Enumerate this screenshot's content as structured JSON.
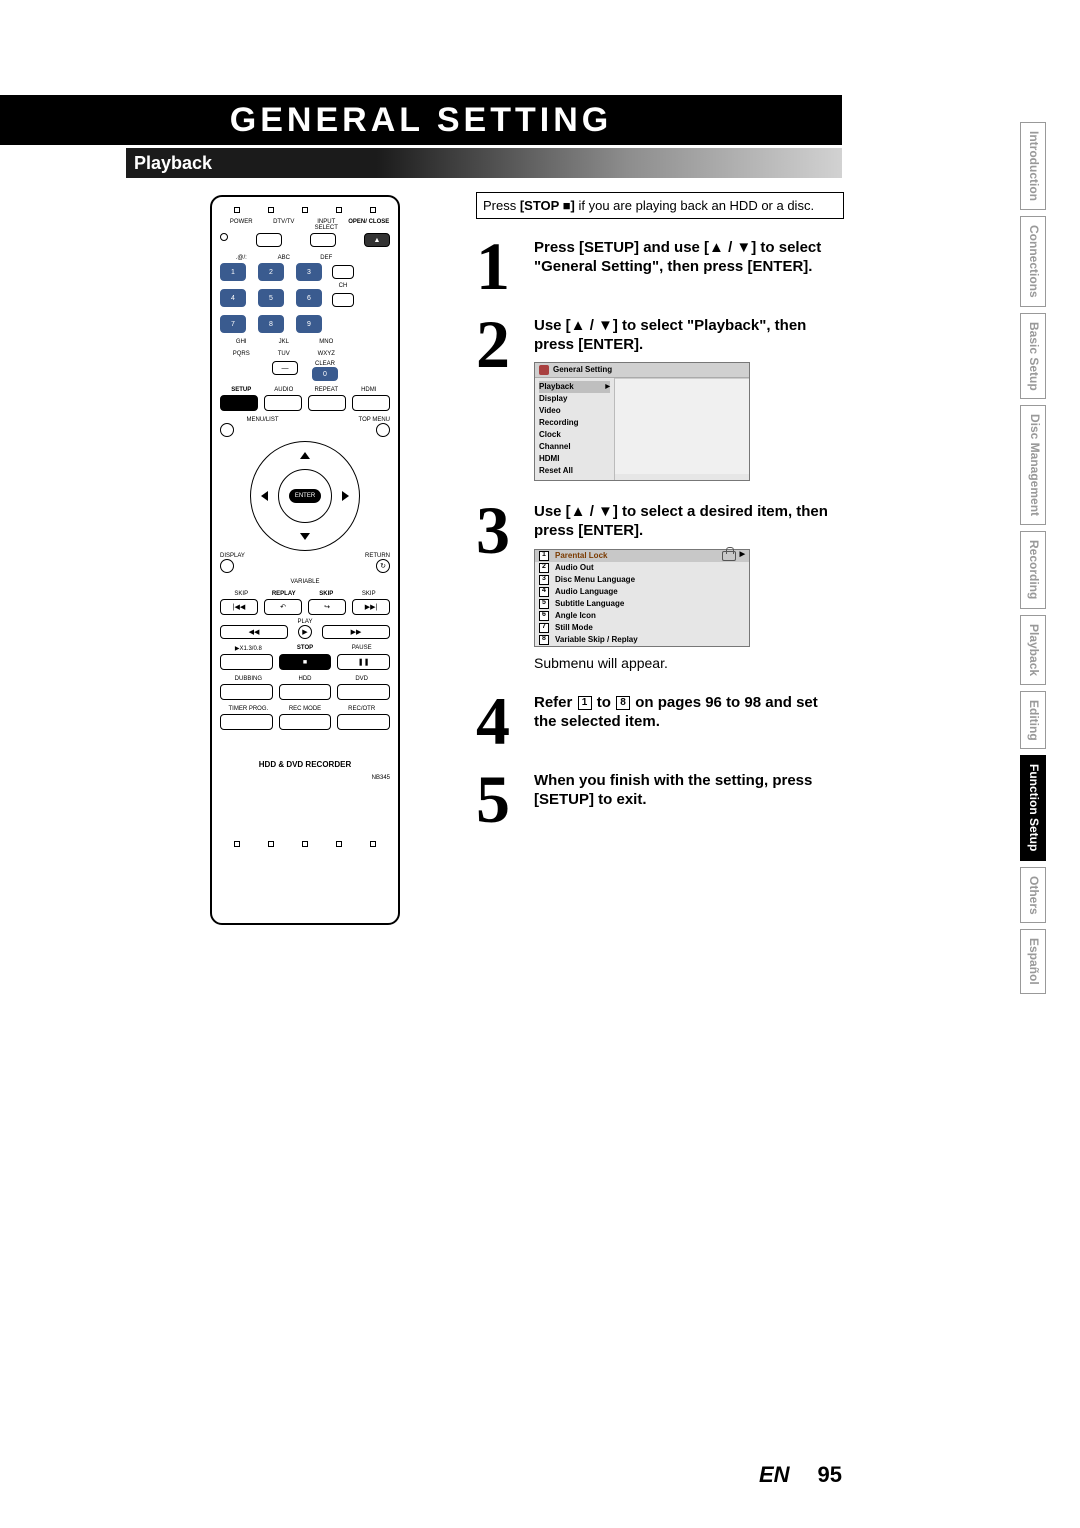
{
  "title": "GENERAL SETTING",
  "subheading": "Playback",
  "side_tabs": {
    "items": [
      {
        "label": "Introduction"
      },
      {
        "label": "Connections"
      },
      {
        "label": "Basic Setup"
      },
      {
        "label": "Disc\nManagement"
      },
      {
        "label": "Recording"
      },
      {
        "label": "Playback"
      },
      {
        "label": "Editing"
      },
      {
        "label": "Function Setup"
      },
      {
        "label": "Others"
      },
      {
        "label": "Español"
      }
    ],
    "active_index": 7
  },
  "remote": {
    "top_labels": [
      "POWER",
      "DTV/TV",
      "INPUT SELECT",
      "OPEN/\nCLOSE"
    ],
    "keypad_labels": [
      ".@/:",
      "ABC",
      "DEF",
      "GHI",
      "JKL",
      "MNO",
      "PQRS",
      "TUV",
      "WXYZ"
    ],
    "keypad_nums": [
      "1",
      "2",
      "3",
      "4",
      "5",
      "6",
      "7",
      "8",
      "9"
    ],
    "ch_label": "CH",
    "clear_label": "CLEAR",
    "zero": "0",
    "row4_labels": [
      "SETUP",
      "AUDIO",
      "REPEAT",
      "HDMI"
    ],
    "menu_list": "MENU/LIST",
    "top_menu": "TOP MENU",
    "enter": "ENTER",
    "display": "DISPLAY",
    "return": "RETURN",
    "variable_lbl": "VARIABLE",
    "skip_labels": [
      "SKIP",
      "REPLAY",
      "SKIP",
      "SKIP"
    ],
    "play_label": "PLAY",
    "x13_label": "▶X1.3/0.8",
    "stop_label": "STOP",
    "pause_label": "PAUSE",
    "dubbing": "DUBBING",
    "hdd": "HDD",
    "dvd": "DVD",
    "timer": "TIMER PROG.",
    "rec_mode": "REC MODE",
    "rec_otr": "REC/OTR",
    "brand": "HDD & DVD RECORDER",
    "model": "NB345"
  },
  "stop_note": {
    "pre": "Press ",
    "bold": "[STOP ■]",
    "post": " if you are playing back an HDD or a disc."
  },
  "steps": [
    {
      "num": "1",
      "bold": "Press [SETUP] and use [▲ / ▼] to select \"General Setting\", then press [ENTER]."
    },
    {
      "num": "2",
      "bold": "Use [▲ / ▼] to select \"Playback\", then press [ENTER]."
    },
    {
      "num": "3",
      "bold": "Use [▲ / ▼] to select a desired item, then press [ENTER].",
      "tail": "Submenu will appear."
    },
    {
      "num": "4",
      "bold_pre": "Refer ",
      "key1": "1",
      "bold_mid": " to ",
      "key2": "8",
      "bold_post": " on pages 96 to 98 and set the selected item."
    },
    {
      "num": "5",
      "bold": "When you finish with the setting, press [SETUP] to exit."
    }
  ],
  "osd1": {
    "title": "General Setting",
    "menu": [
      "Playback",
      "Display",
      "Video",
      "Recording",
      "Clock",
      "Channel",
      "HDMI",
      "Reset All"
    ],
    "selected_index": 0
  },
  "osd2": {
    "items": [
      {
        "n": "1",
        "label": "Parental Lock",
        "locked": true
      },
      {
        "n": "2",
        "label": "Audio Out"
      },
      {
        "n": "3",
        "label": "Disc Menu Language"
      },
      {
        "n": "4",
        "label": "Audio Language"
      },
      {
        "n": "5",
        "label": "Subtitle Language"
      },
      {
        "n": "6",
        "label": "Angle Icon"
      },
      {
        "n": "7",
        "label": "Still Mode"
      },
      {
        "n": "8",
        "label": "Variable Skip / Replay"
      }
    ],
    "selected_index": 0
  },
  "footer": {
    "en": "EN",
    "page": "95"
  }
}
